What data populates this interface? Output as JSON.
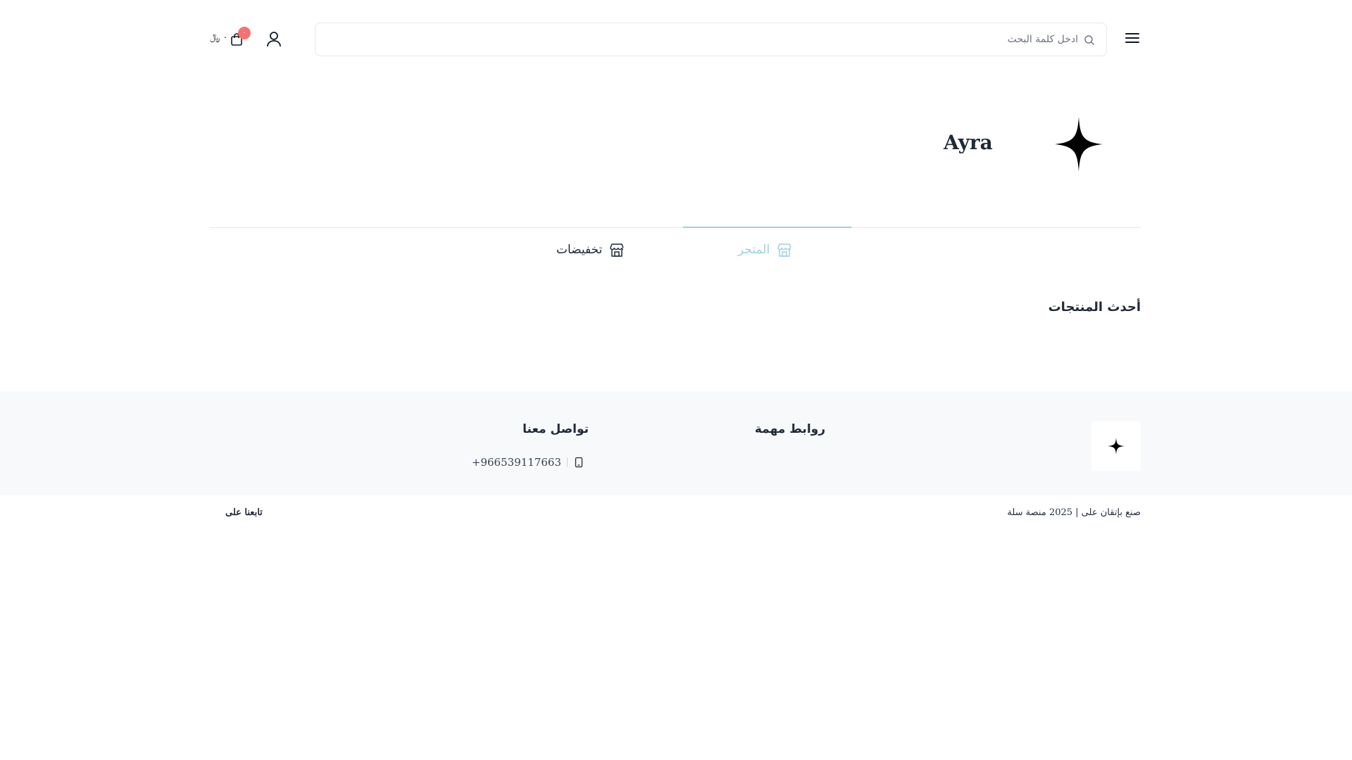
{
  "header": {
    "menu_icon": "hamburger-menu-icon",
    "search": {
      "placeholder": "ادخل كلمة البحث",
      "value": "",
      "icon": "search-icon"
    },
    "user_icon": "user-icon",
    "cart": {
      "icon": "shopping-bag-icon",
      "badge_count": "٠",
      "total": "٠ ﷼"
    }
  },
  "store": {
    "name": "Ayra",
    "logo_icon": "four-point-star-icon"
  },
  "tabs": [
    {
      "label": "المتجر",
      "icon": "store-icon",
      "active": true
    },
    {
      "label": "تخفيضات",
      "icon": "store-icon",
      "active": false
    }
  ],
  "sections": {
    "latest_products_title": "أحدث المنتجات"
  },
  "footer": {
    "logo_icon": "four-point-star-icon",
    "links_heading": "روابط مهمة",
    "contact_heading": "تواصل معنا",
    "phone": "+966539117663",
    "phone_icon": "mobile-phone-icon",
    "copyright": "صنع بإتقان على | 2025 منصة سلة",
    "follow_label": "تابعنا على"
  },
  "colors": {
    "accent": "#9fd0e0",
    "badge": "#f87171",
    "footer_bg": "#f8f9fa",
    "border": "#e5e7eb"
  }
}
